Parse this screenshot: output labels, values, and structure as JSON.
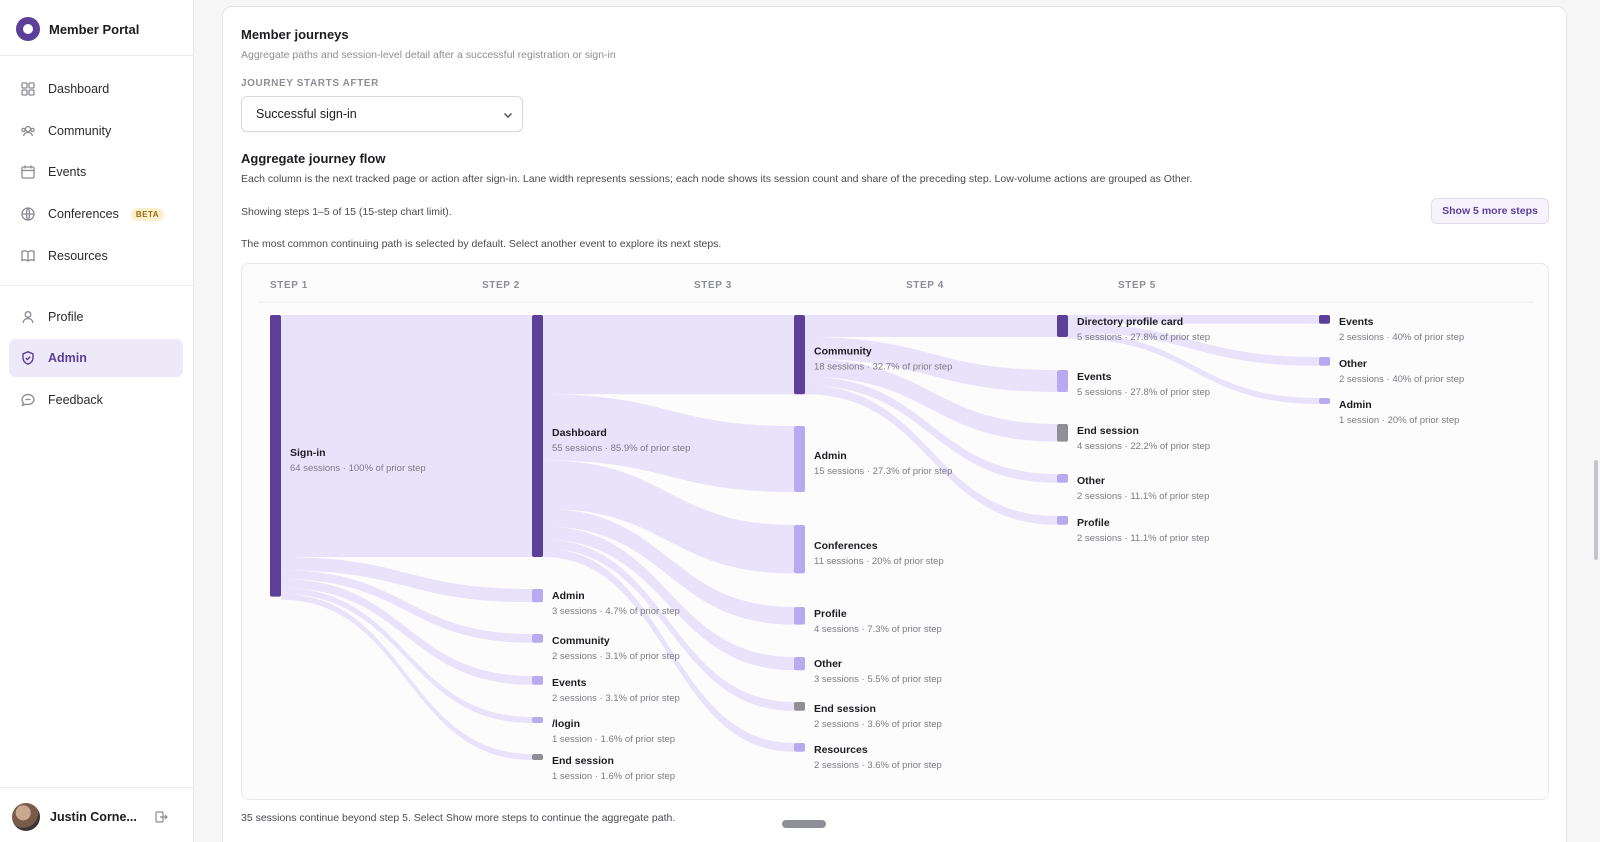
{
  "app": {
    "name": "Member Portal"
  },
  "sidebar": {
    "items": [
      {
        "key": "dashboard",
        "label": "Dashboard",
        "icon": "grid-icon"
      },
      {
        "key": "community",
        "label": "Community",
        "icon": "users-icon"
      },
      {
        "key": "events",
        "label": "Events",
        "icon": "calendar-icon"
      },
      {
        "key": "conferences",
        "label": "Conferences",
        "icon": "globe-icon",
        "badge": "BETA"
      },
      {
        "key": "resources",
        "label": "Resources",
        "icon": "book-icon"
      },
      {
        "key": "profile",
        "label": "Profile",
        "icon": "user-icon"
      },
      {
        "key": "admin",
        "label": "Admin",
        "icon": "shield-icon",
        "active": true
      },
      {
        "key": "feedback",
        "label": "Feedback",
        "icon": "chat-icon"
      }
    ],
    "user": {
      "name": "Justin Corne..."
    }
  },
  "journeys": {
    "title": "Member journeys",
    "subtitle": "Aggregate paths and session-level detail after a successful registration or sign-in",
    "start_label": "JOURNEY STARTS AFTER",
    "start_value": "Successful sign-in"
  },
  "flow": {
    "title": "Aggregate journey flow",
    "description": "Each column is the next tracked page or action after sign-in. Lane width represents sessions; each node shows its session count and share of the preceding step. Low-volume actions are grouped as Other.",
    "showing": "Showing steps 1–5 of 15 (15-step chart limit).",
    "more_button": "Show 5 more steps",
    "hint": "The most common continuing path is selected by default. Select another event to explore its next steps.",
    "footnote": "35 sessions continue beyond step 5. Select Show more steps to continue the aggregate path."
  },
  "chart_data": {
    "type": "sankey",
    "steps": [
      "STEP 1",
      "STEP 2",
      "STEP 3",
      "STEP 4",
      "STEP 5"
    ],
    "columns": [
      [
        {
          "id": "s1-signin",
          "label": "Sign-in",
          "meta": "64 sessions · 100% of prior step",
          "sessions": 64,
          "selected": true
        }
      ],
      [
        {
          "id": "s2-dashboard",
          "label": "Dashboard",
          "meta": "55 sessions · 85.9% of prior step",
          "sessions": 55,
          "selected": true
        },
        {
          "id": "s2-admin",
          "label": "Admin",
          "meta": "3 sessions · 4.7% of prior step",
          "sessions": 3
        },
        {
          "id": "s2-community",
          "label": "Community",
          "meta": "2 sessions · 3.1% of prior step",
          "sessions": 2
        },
        {
          "id": "s2-events",
          "label": "Events",
          "meta": "2 sessions · 3.1% of prior step",
          "sessions": 2
        },
        {
          "id": "s2-login",
          "label": "/login",
          "meta": "1 session · 1.6% of prior step",
          "sessions": 1
        },
        {
          "id": "s2-end",
          "label": "End session",
          "meta": "1 session · 1.6% of prior step",
          "sessions": 1,
          "end": true
        }
      ],
      [
        {
          "id": "s3-community",
          "label": "Community",
          "meta": "18 sessions · 32.7% of prior step",
          "sessions": 18,
          "selected": true
        },
        {
          "id": "s3-admin",
          "label": "Admin",
          "meta": "15 sessions · 27.3% of prior step",
          "sessions": 15
        },
        {
          "id": "s3-conferences",
          "label": "Conferences",
          "meta": "11 sessions · 20% of prior step",
          "sessions": 11
        },
        {
          "id": "s3-profile",
          "label": "Profile",
          "meta": "4 sessions · 7.3% of prior step",
          "sessions": 4
        },
        {
          "id": "s3-other",
          "label": "Other",
          "meta": "3 sessions · 5.5% of prior step",
          "sessions": 3
        },
        {
          "id": "s3-end",
          "label": "End session",
          "meta": "2 sessions · 3.6% of prior step",
          "sessions": 2,
          "end": true
        },
        {
          "id": "s3-resources",
          "label": "Resources",
          "meta": "2 sessions · 3.6% of prior step",
          "sessions": 2
        }
      ],
      [
        {
          "id": "s4-directory",
          "label": "Directory profile card",
          "meta": "5 sessions · 27.8% of prior step",
          "sessions": 5,
          "selected": true
        },
        {
          "id": "s4-events",
          "label": "Events",
          "meta": "5 sessions · 27.8% of prior step",
          "sessions": 5
        },
        {
          "id": "s4-end",
          "label": "End session",
          "meta": "4 sessions · 22.2% of prior step",
          "sessions": 4,
          "end": true
        },
        {
          "id": "s4-other",
          "label": "Other",
          "meta": "2 sessions · 11.1% of prior step",
          "sessions": 2
        },
        {
          "id": "s4-profile",
          "label": "Profile",
          "meta": "2 sessions · 11.1% of prior step",
          "sessions": 2
        }
      ],
      [
        {
          "id": "s5-events",
          "label": "Events",
          "meta": "2 sessions · 40% of prior step",
          "sessions": 2,
          "selected": true
        },
        {
          "id": "s5-other",
          "label": "Other",
          "meta": "2 sessions · 40% of prior step",
          "sessions": 2
        },
        {
          "id": "s5-admin",
          "label": "Admin",
          "meta": "1 session · 20% of prior step",
          "sessions": 1
        }
      ]
    ],
    "colors": {
      "selected": "#5b3f99",
      "node": "#b8aaf0",
      "end": "#8f8f95",
      "link": "#e5dffb"
    }
  }
}
